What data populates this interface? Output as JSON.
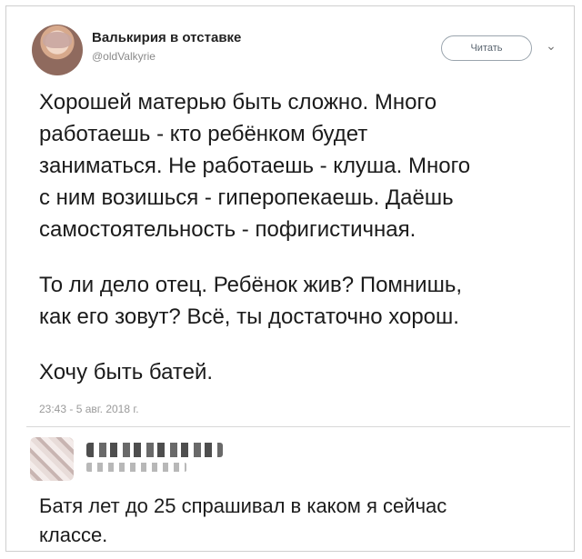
{
  "tweet": {
    "author_name": "Валькирия в отставке",
    "author_handle": "@oldValkyrie",
    "follow_label": "Читать",
    "chevron_icon": "chevron-down-icon",
    "paragraphs": [
      "Хорошей матерью быть сложно. Много\nработаешь - кто ребёнком будет\nзаниматься. Не работаешь - клуша. Много\nс ним возишься - гиперопекаешь. Даёшь\nсамостоятельность - пофигистичная.",
      "То ли дело отец. Ребёнок жив? Помнишь,\nкак его зовут? Всё, ты достаточно хорош.",
      "Хочу быть батей."
    ],
    "timestamp": "23:43 - 5 авг. 2018 г."
  },
  "reply": {
    "text": "Батя лет до 25 спрашивал в каком я сейчас\nклассе."
  }
}
